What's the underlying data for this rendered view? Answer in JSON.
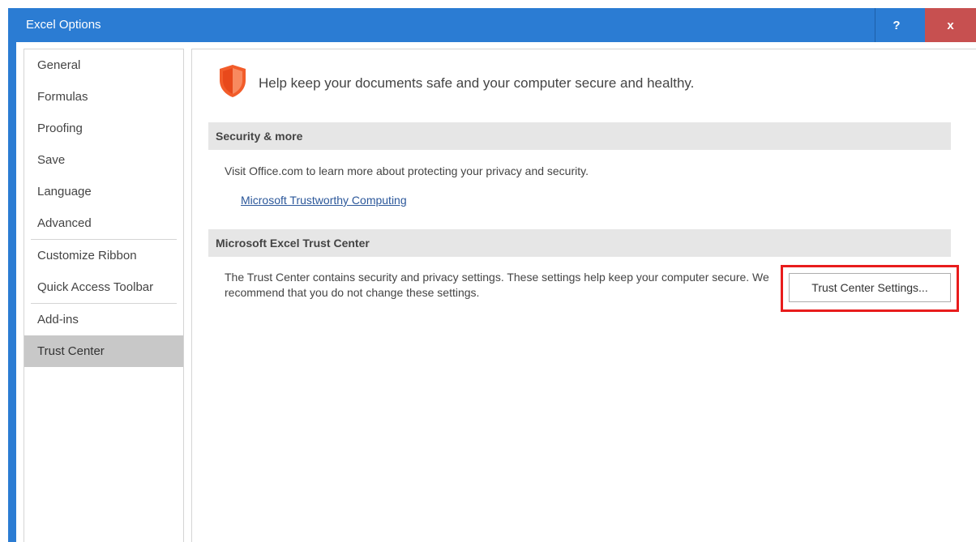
{
  "window": {
    "title": "Excel Options",
    "help_label": "?",
    "close_label": "x"
  },
  "sidebar": {
    "items": [
      {
        "label": "General"
      },
      {
        "label": "Formulas"
      },
      {
        "label": "Proofing"
      },
      {
        "label": "Save"
      },
      {
        "label": "Language"
      },
      {
        "label": "Advanced"
      },
      {
        "label": "Customize Ribbon"
      },
      {
        "label": "Quick Access Toolbar"
      },
      {
        "label": "Add-ins"
      },
      {
        "label": "Trust Center"
      }
    ],
    "selected": "Trust Center"
  },
  "main": {
    "header_text": "Help keep your documents safe and your computer secure and healthy.",
    "security_section": {
      "title": "Security & more",
      "description": "Visit Office.com to learn more about protecting your privacy and security.",
      "link_text": "Microsoft Trustworthy Computing"
    },
    "trust_center_section": {
      "title": "Microsoft Excel Trust Center",
      "description": "The Trust Center contains security and privacy settings. These settings help keep your computer secure. We recommend that you do not change these settings.",
      "button_label": "Trust Center Settings..."
    }
  },
  "colors": {
    "titlebar": "#2b7cd3",
    "close": "#c75050",
    "highlight": "#e81c1c",
    "shield": "#f25c2a",
    "link": "#2b579a"
  },
  "icons": {
    "shield": "shield-icon"
  }
}
